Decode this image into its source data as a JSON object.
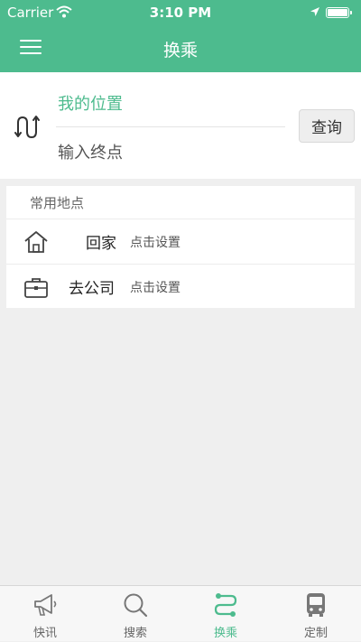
{
  "status_bar": {
    "carrier": "Carrier",
    "time": "3:10 PM"
  },
  "nav": {
    "title": "换乘",
    "menu_icon": "hamburger-menu-icon"
  },
  "route": {
    "from_value": "我的位置",
    "to_placeholder": "输入终点",
    "query_label": "查询",
    "swap_icon": "swap-route-icon"
  },
  "places": {
    "title": "常用地点",
    "items": [
      {
        "name": "回家",
        "action": "点击设置",
        "icon": "home-icon"
      },
      {
        "name": "去公司",
        "action": "点击设置",
        "icon": "briefcase-icon"
      }
    ]
  },
  "tabbar": {
    "tabs": [
      {
        "label": "快讯",
        "icon": "megaphone-icon"
      },
      {
        "label": "搜索",
        "icon": "search-icon"
      },
      {
        "label": "换乘",
        "icon": "transfer-route-icon"
      },
      {
        "label": "定制",
        "icon": "bus-icon"
      }
    ],
    "active_index": 2
  },
  "colors": {
    "accent": "#4dbb8e",
    "background": "#efefef",
    "card": "#ffffff"
  }
}
